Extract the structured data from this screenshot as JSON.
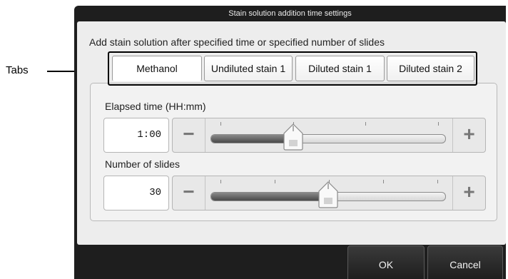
{
  "callout": {
    "label": "Tabs"
  },
  "dialog": {
    "title": "Stain solution addition time settings",
    "instruction": "Add stain solution after specified time or specified number of slides",
    "tabs": [
      {
        "label": "Methanol",
        "active": true
      },
      {
        "label": "Undiluted stain 1",
        "active": false
      },
      {
        "label": "Diluted stain 1",
        "active": false
      },
      {
        "label": "Diluted stain 2",
        "active": false
      }
    ],
    "elapsed_time": {
      "label": "Elapsed time (HH:mm)",
      "value": "1:00",
      "minus_icon": "minus-icon",
      "plus_icon": "plus-icon",
      "slider_fraction": 0.35
    },
    "number_of_slides": {
      "label": "Number of slides",
      "value": "30",
      "minus_icon": "minus-icon",
      "plus_icon": "plus-icon",
      "slider_fraction": 0.5
    },
    "buttons": {
      "ok": "OK",
      "cancel": "Cancel"
    }
  },
  "colors": {
    "dialog_background": "#1e1e1e",
    "panel_background": "#ededed",
    "slider_fill": "#4a4a4a"
  }
}
